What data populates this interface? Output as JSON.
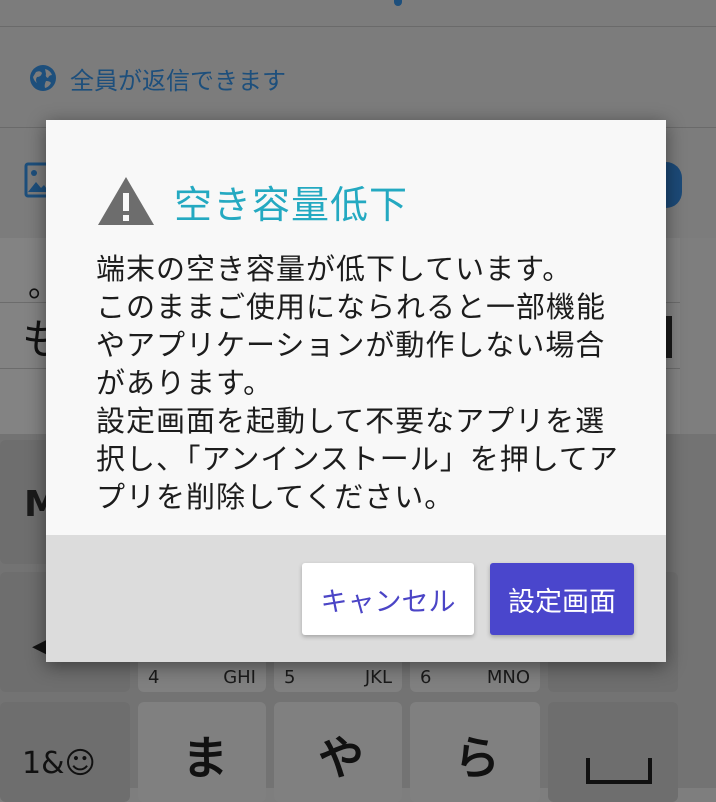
{
  "background": {
    "reply_setting": "全員が返信できます",
    "candidate_line1": "。",
    "candidate_line2": "も",
    "keyboard": {
      "keys": [
        {
          "num": "4",
          "letters": "GHI"
        },
        {
          "num": "5",
          "letters": "JKL"
        },
        {
          "num": "6",
          "letters": "MNO"
        }
      ],
      "kana_keys": [
        "ま",
        "や",
        "ら"
      ],
      "mode_key": "M",
      "arrow_key": "◀",
      "symbol_key": "1&☺"
    }
  },
  "dialog": {
    "title": "空き容量低下",
    "message": "端末の空き容量が低下しています。\nこのままご使用になられると一部機能やアプリケーションが動作しない場合があります。\n設定画面を起動して不要なアプリを選択し、「アンインストール」を押してアプリを削除してください。",
    "cancel_label": "キャンセル",
    "settings_label": "設定画面"
  },
  "colors": {
    "title": "#24a9c1",
    "primary_button": "#4a46cc",
    "link": "#1d4f7c"
  }
}
